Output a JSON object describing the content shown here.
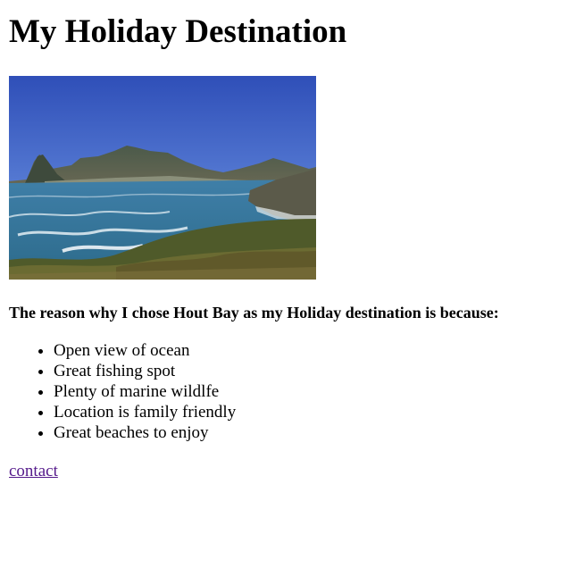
{
  "page": {
    "title": "My Holiday Destination",
    "image_description": "",
    "reason_heading": "The reason why I chose Hout Bay as my Holiday destination is because:",
    "reasons": [
      "Open view of ocean",
      "Great fishing spot",
      "Plenty of marine wildlfe",
      "Location is family friendly",
      "Great beaches to enjoy"
    ],
    "contact_link": "contact"
  },
  "colors": {
    "link_visited": "#551a8b",
    "text": "#000000",
    "background": "#ffffff"
  }
}
